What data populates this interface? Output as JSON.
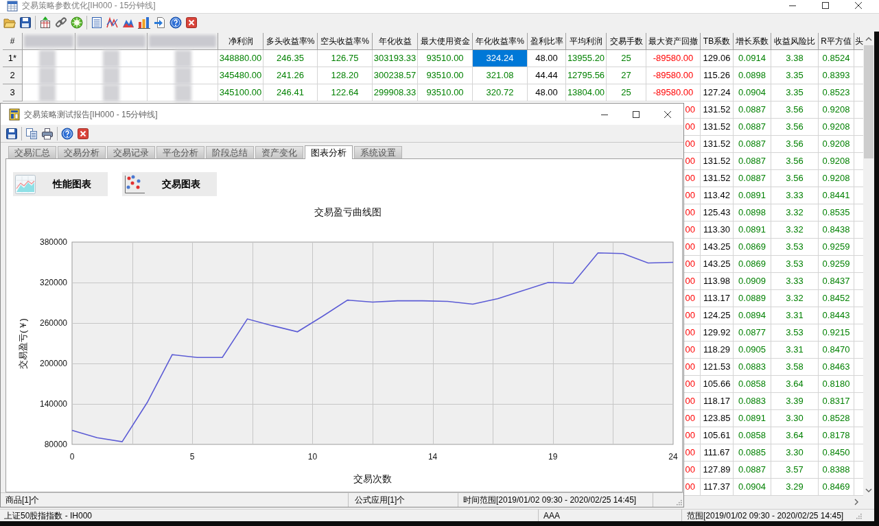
{
  "main_window": {
    "title": "交易策略参数优化[IH000 - 15分钟线]"
  },
  "table": {
    "columns": [
      {
        "kind": "index",
        "label": "#"
      },
      {
        "kind": "blurred"
      },
      {
        "kind": "blurred"
      },
      {
        "kind": "blurred"
      },
      {
        "kind": "value",
        "label": "净利润",
        "color": "#008000"
      },
      {
        "kind": "value",
        "label": "多头收益率%",
        "color": "#008000"
      },
      {
        "kind": "value",
        "label": "空头收益率%",
        "color": "#008000"
      },
      {
        "kind": "value",
        "label": "年化收益",
        "color": "#008000"
      },
      {
        "kind": "value",
        "label": "最大使用资金",
        "color": "#008000"
      },
      {
        "kind": "value",
        "label": "年化收益率%",
        "color": "#008000"
      },
      {
        "kind": "value",
        "label": "盈利比率",
        "color": "#000000"
      },
      {
        "kind": "value",
        "label": "平均利润",
        "color": "#008000"
      },
      {
        "kind": "value",
        "label": "交易手数",
        "color": "#008000"
      },
      {
        "kind": "value",
        "label": "最大资产回撤",
        "color": "#ff0000"
      },
      {
        "kind": "value",
        "label": "TB系数",
        "color": "#000000"
      },
      {
        "kind": "value",
        "label": "增长系数",
        "color": "#008000"
      },
      {
        "kind": "value",
        "label": "收益风险比",
        "color": "#008000"
      },
      {
        "kind": "value",
        "label": "R平方值",
        "color": "#008000"
      },
      {
        "kind": "value",
        "label": "头"
      }
    ],
    "rows": [
      {
        "cells": [
          "1*",
          "",
          "",
          "",
          {
            "text": "348880.00",
            "selected": false
          },
          {
            "text": "246.35",
            "selected": false
          },
          {
            "text": "126.75",
            "selected": false
          },
          {
            "text": "303193.33",
            "selected": false
          },
          {
            "text": "93510.00",
            "selected": false
          },
          {
            "text": "324.24",
            "selected": true
          },
          {
            "text": "48.00",
            "selected": false
          },
          {
            "text": "13955.20",
            "selected": false
          },
          {
            "text": "25",
            "selected": false
          },
          {
            "text": "-89580.00",
            "selected": false
          },
          {
            "text": "129.06",
            "selected": false
          },
          {
            "text": "0.0914",
            "selected": false
          },
          {
            "text": "3.38",
            "selected": false
          },
          {
            "text": "0.8524",
            "selected": false
          }
        ]
      },
      {
        "cells": [
          "2",
          "",
          "",
          "",
          {
            "text": "345480.00",
            "selected": false
          },
          {
            "text": "241.26",
            "selected": false
          },
          {
            "text": "128.20",
            "selected": false
          },
          {
            "text": "300238.57",
            "selected": false
          },
          {
            "text": "93510.00",
            "selected": false
          },
          {
            "text": "321.08",
            "selected": false
          },
          {
            "text": "44.44",
            "selected": false
          },
          {
            "text": "12795.56",
            "selected": false
          },
          {
            "text": "27",
            "selected": false
          },
          {
            "text": "-89580.00",
            "selected": false
          },
          {
            "text": "115.26",
            "selected": false
          },
          {
            "text": "0.0898",
            "selected": false
          },
          {
            "text": "3.35",
            "selected": false
          },
          {
            "text": "0.8393",
            "selected": false
          }
        ]
      },
      {
        "cells": [
          "3",
          "",
          "",
          "",
          {
            "text": "345100.00",
            "selected": false
          },
          {
            "text": "246.41",
            "selected": false
          },
          {
            "text": "122.64",
            "selected": false
          },
          {
            "text": "299908.33",
            "selected": false
          },
          {
            "text": "93510.00",
            "selected": false
          },
          {
            "text": "320.72",
            "selected": false
          },
          {
            "text": "48.00",
            "selected": false
          },
          {
            "text": "13804.00",
            "selected": false
          },
          {
            "text": "25",
            "selected": false
          },
          {
            "text": "-89580.00",
            "selected": false
          },
          {
            "text": "127.24",
            "selected": false
          },
          {
            "text": "0.0904",
            "selected": false
          },
          {
            "text": "3.35",
            "selected": false
          },
          {
            "text": "0.8523",
            "selected": false
          }
        ]
      },
      {
        "cells": [
          "",
          "",
          "",
          "",
          "",
          "",
          "",
          "",
          "",
          "",
          "",
          "",
          "",
          {
            "text": "00",
            "selected": false
          },
          {
            "text": "131.52",
            "selected": false
          },
          {
            "text": "0.0887",
            "selected": false
          },
          {
            "text": "3.56",
            "selected": false
          },
          {
            "text": "0.9208",
            "selected": false
          }
        ]
      },
      {
        "cells": [
          "",
          "",
          "",
          "",
          "",
          "",
          "",
          "",
          "",
          "",
          "",
          "",
          "",
          {
            "text": "00",
            "selected": false
          },
          {
            "text": "131.52",
            "selected": false
          },
          {
            "text": "0.0887",
            "selected": false
          },
          {
            "text": "3.56",
            "selected": false
          },
          {
            "text": "0.9208",
            "selected": false
          }
        ]
      },
      {
        "cells": [
          "",
          "",
          "",
          "",
          "",
          "",
          "",
          "",
          "",
          "",
          "",
          "",
          "",
          {
            "text": "00",
            "selected": false
          },
          {
            "text": "131.52",
            "selected": false
          },
          {
            "text": "0.0887",
            "selected": false
          },
          {
            "text": "3.56",
            "selected": false
          },
          {
            "text": "0.9208",
            "selected": false
          }
        ]
      },
      {
        "cells": [
          "",
          "",
          "",
          "",
          "",
          "",
          "",
          "",
          "",
          "",
          "",
          "",
          "",
          {
            "text": "00",
            "selected": false
          },
          {
            "text": "131.52",
            "selected": false
          },
          {
            "text": "0.0887",
            "selected": false
          },
          {
            "text": "3.56",
            "selected": false
          },
          {
            "text": "0.9208",
            "selected": false
          }
        ]
      },
      {
        "cells": [
          "",
          "",
          "",
          "",
          "",
          "",
          "",
          "",
          "",
          "",
          "",
          "",
          "",
          {
            "text": "00",
            "selected": false
          },
          {
            "text": "131.52",
            "selected": false
          },
          {
            "text": "0.0887",
            "selected": false
          },
          {
            "text": "3.56",
            "selected": false
          },
          {
            "text": "0.9208",
            "selected": false
          }
        ]
      },
      {
        "cells": [
          "",
          "",
          "",
          "",
          "",
          "",
          "",
          "",
          "",
          "",
          "",
          "",
          "",
          {
            "text": "00",
            "selected": false
          },
          {
            "text": "113.42",
            "selected": false
          },
          {
            "text": "0.0891",
            "selected": false
          },
          {
            "text": "3.33",
            "selected": false
          },
          {
            "text": "0.8441",
            "selected": false
          }
        ]
      },
      {
        "cells": [
          "",
          "",
          "",
          "",
          "",
          "",
          "",
          "",
          "",
          "",
          "",
          "",
          "",
          {
            "text": "00",
            "selected": false
          },
          {
            "text": "125.43",
            "selected": false
          },
          {
            "text": "0.0898",
            "selected": false
          },
          {
            "text": "3.32",
            "selected": false
          },
          {
            "text": "0.8535",
            "selected": false
          }
        ]
      },
      {
        "cells": [
          "",
          "",
          "",
          "",
          "",
          "",
          "",
          "",
          "",
          "",
          "",
          "",
          "",
          {
            "text": "00",
            "selected": false
          },
          {
            "text": "113.30",
            "selected": false
          },
          {
            "text": "0.0891",
            "selected": false
          },
          {
            "text": "3.32",
            "selected": false
          },
          {
            "text": "0.8438",
            "selected": false
          }
        ]
      },
      {
        "cells": [
          "",
          "",
          "",
          "",
          "",
          "",
          "",
          "",
          "",
          "",
          "",
          "",
          "",
          {
            "text": "00",
            "selected": false
          },
          {
            "text": "143.25",
            "selected": false
          },
          {
            "text": "0.0869",
            "selected": false
          },
          {
            "text": "3.53",
            "selected": false
          },
          {
            "text": "0.9259",
            "selected": false
          }
        ]
      },
      {
        "cells": [
          "",
          "",
          "",
          "",
          "",
          "",
          "",
          "",
          "",
          "",
          "",
          "",
          "",
          {
            "text": "00",
            "selected": false
          },
          {
            "text": "143.25",
            "selected": false
          },
          {
            "text": "0.0869",
            "selected": false
          },
          {
            "text": "3.53",
            "selected": false
          },
          {
            "text": "0.9259",
            "selected": false
          }
        ]
      },
      {
        "cells": [
          "",
          "",
          "",
          "",
          "",
          "",
          "",
          "",
          "",
          "",
          "",
          "",
          "",
          {
            "text": "00",
            "selected": false
          },
          {
            "text": "113.98",
            "selected": false
          },
          {
            "text": "0.0909",
            "selected": false
          },
          {
            "text": "3.33",
            "selected": false
          },
          {
            "text": "0.8437",
            "selected": false
          }
        ]
      },
      {
        "cells": [
          "",
          "",
          "",
          "",
          "",
          "",
          "",
          "",
          "",
          "",
          "",
          "",
          "",
          {
            "text": "00",
            "selected": false
          },
          {
            "text": "113.17",
            "selected": false
          },
          {
            "text": "0.0889",
            "selected": false
          },
          {
            "text": "3.32",
            "selected": false
          },
          {
            "text": "0.8452",
            "selected": false
          }
        ]
      },
      {
        "cells": [
          "",
          "",
          "",
          "",
          "",
          "",
          "",
          "",
          "",
          "",
          "",
          "",
          "",
          {
            "text": "00",
            "selected": false
          },
          {
            "text": "124.25",
            "selected": false
          },
          {
            "text": "0.0894",
            "selected": false
          },
          {
            "text": "3.31",
            "selected": false
          },
          {
            "text": "0.8443",
            "selected": false
          }
        ]
      },
      {
        "cells": [
          "",
          "",
          "",
          "",
          "",
          "",
          "",
          "",
          "",
          "",
          "",
          "",
          "",
          {
            "text": "00",
            "selected": false
          },
          {
            "text": "129.92",
            "selected": false
          },
          {
            "text": "0.0877",
            "selected": false
          },
          {
            "text": "3.53",
            "selected": false
          },
          {
            "text": "0.9215",
            "selected": false
          }
        ]
      },
      {
        "cells": [
          "",
          "",
          "",
          "",
          "",
          "",
          "",
          "",
          "",
          "",
          "",
          "",
          "",
          {
            "text": "00",
            "selected": false
          },
          {
            "text": "118.29",
            "selected": false
          },
          {
            "text": "0.0905",
            "selected": false
          },
          {
            "text": "3.31",
            "selected": false
          },
          {
            "text": "0.8470",
            "selected": false
          }
        ]
      },
      {
        "cells": [
          "",
          "",
          "",
          "",
          "",
          "",
          "",
          "",
          "",
          "",
          "",
          "",
          "",
          {
            "text": "00",
            "selected": false
          },
          {
            "text": "121.53",
            "selected": false
          },
          {
            "text": "0.0883",
            "selected": false
          },
          {
            "text": "3.58",
            "selected": false
          },
          {
            "text": "0.8463",
            "selected": false
          }
        ]
      },
      {
        "cells": [
          "",
          "",
          "",
          "",
          "",
          "",
          "",
          "",
          "",
          "",
          "",
          "",
          "",
          {
            "text": "00",
            "selected": false
          },
          {
            "text": "105.66",
            "selected": false
          },
          {
            "text": "0.0858",
            "selected": false
          },
          {
            "text": "3.64",
            "selected": false
          },
          {
            "text": "0.8180",
            "selected": false
          }
        ]
      },
      {
        "cells": [
          "",
          "",
          "",
          "",
          "",
          "",
          "",
          "",
          "",
          "",
          "",
          "",
          "",
          {
            "text": "00",
            "selected": false
          },
          {
            "text": "118.17",
            "selected": false
          },
          {
            "text": "0.0883",
            "selected": false
          },
          {
            "text": "3.39",
            "selected": false
          },
          {
            "text": "0.8317",
            "selected": false
          }
        ]
      },
      {
        "cells": [
          "",
          "",
          "",
          "",
          "",
          "",
          "",
          "",
          "",
          "",
          "",
          "",
          "",
          {
            "text": "00",
            "selected": false
          },
          {
            "text": "123.85",
            "selected": false
          },
          {
            "text": "0.0891",
            "selected": false
          },
          {
            "text": "3.30",
            "selected": false
          },
          {
            "text": "0.8528",
            "selected": false
          }
        ]
      },
      {
        "cells": [
          "",
          "",
          "",
          "",
          "",
          "",
          "",
          "",
          "",
          "",
          "",
          "",
          "",
          {
            "text": "00",
            "selected": false
          },
          {
            "text": "105.61",
            "selected": false
          },
          {
            "text": "0.0858",
            "selected": false
          },
          {
            "text": "3.64",
            "selected": false
          },
          {
            "text": "0.8178",
            "selected": false
          }
        ]
      },
      {
        "cells": [
          "",
          "",
          "",
          "",
          "",
          "",
          "",
          "",
          "",
          "",
          "",
          "",
          "",
          {
            "text": "00",
            "selected": false
          },
          {
            "text": "111.67",
            "selected": false
          },
          {
            "text": "0.0885",
            "selected": false
          },
          {
            "text": "3.30",
            "selected": false
          },
          {
            "text": "0.8450",
            "selected": false
          }
        ]
      },
      {
        "cells": [
          "",
          "",
          "",
          "",
          "",
          "",
          "",
          "",
          "",
          "",
          "",
          "",
          "",
          {
            "text": "00",
            "selected": false
          },
          {
            "text": "127.89",
            "selected": false
          },
          {
            "text": "0.0887",
            "selected": false
          },
          {
            "text": "3.57",
            "selected": false
          },
          {
            "text": "0.8388",
            "selected": false
          }
        ]
      },
      {
        "cells": [
          "",
          "",
          "",
          "",
          "",
          "",
          "",
          "",
          "",
          "",
          "",
          "",
          "",
          {
            "text": "00",
            "selected": false
          },
          {
            "text": "117.37",
            "selected": false
          },
          {
            "text": "0.0904",
            "selected": false
          },
          {
            "text": "3.29",
            "selected": false
          },
          {
            "text": "0.8469",
            "selected": false
          }
        ]
      }
    ]
  },
  "report_window": {
    "title": "交易策略测试报告[IH000 - 15分钟线]",
    "tabs": [
      {
        "label": "交易汇总",
        "selected": false
      },
      {
        "label": "交易分析",
        "selected": false
      },
      {
        "label": "交易记录",
        "selected": false
      },
      {
        "label": "平仓分析",
        "selected": false
      },
      {
        "label": "阶段总结",
        "selected": false
      },
      {
        "label": "资产变化",
        "selected": false
      },
      {
        "label": "图表分析",
        "selected": true
      },
      {
        "label": "系统设置",
        "selected": false
      }
    ],
    "chart_buttons": [
      {
        "label": "性能图表"
      },
      {
        "label": "交易图表"
      }
    ],
    "chart": {
      "chart_data": {
        "type": "line",
        "title": "交易盈亏曲线图",
        "xlabel": "交易次数",
        "ylabel": "交易盈亏(￥)",
        "x": [
          0,
          1,
          2,
          3,
          4,
          5,
          6,
          7,
          8,
          9,
          10,
          11,
          12,
          13,
          14,
          15,
          16,
          17,
          18,
          19,
          20,
          21,
          22,
          23,
          24
        ],
        "values": [
          101000,
          90000,
          84000,
          142000,
          213000,
          209000,
          209000,
          266000,
          256000,
          247000,
          270000,
          294000,
          291000,
          293000,
          293000,
          292000,
          288000,
          296000,
          308000,
          320000,
          319000,
          364000,
          363000,
          349000,
          350000
        ],
        "xlim": [
          0,
          24
        ],
        "ylim": [
          80000,
          380000
        ],
        "xticks": [
          {
            "value": 0,
            "label": "0"
          },
          {
            "value": 4.8,
            "label": "5"
          },
          {
            "value": 9.6,
            "label": "10"
          },
          {
            "value": 14.4,
            "label": "14"
          },
          {
            "value": 19.2,
            "label": "19"
          },
          {
            "value": 24,
            "label": "24"
          }
        ],
        "yticks": [
          80000,
          140000,
          200000,
          260000,
          320000,
          380000
        ],
        "grid": true
      }
    },
    "status_bar": [
      "商品[1]个",
      "公式应用[1]个",
      "时间范围[2019/01/02 09:30 - 2020/02/25 14:45]"
    ]
  },
  "status_bar": [
    "上证50股指指数 - IH000",
    "AAA",
    "范围[2019/01/02 09:30 - 2020/02/25 14:45]"
  ]
}
